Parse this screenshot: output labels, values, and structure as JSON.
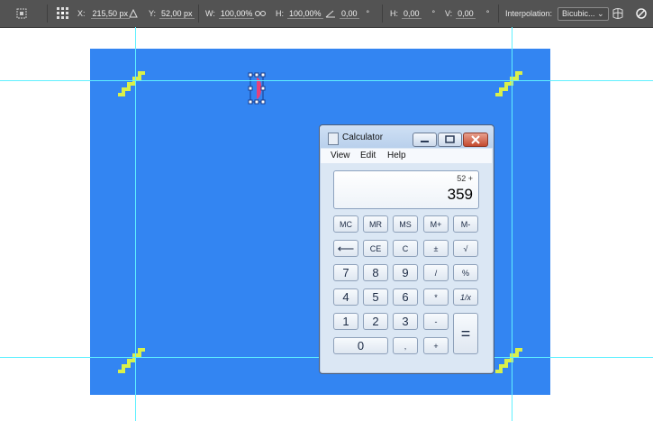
{
  "options_bar": {
    "x_label": "X:",
    "x_value": "215,50 px",
    "y_label": "Y:",
    "y_value": "52,00 px",
    "w_label": "W:",
    "w_value": "100,00%",
    "h_label": "H:",
    "h_value": "100,00%",
    "angle_value": "0,00",
    "angle_unit": "°",
    "hskew_label": "H:",
    "hskew_value": "0,00",
    "hskew_unit": "°",
    "vskew_label": "V:",
    "vskew_value": "0,00",
    "vskew_unit": "°",
    "interpolation_label": "Interpolation:",
    "interpolation_value": "Bicubic..."
  },
  "calculator": {
    "title": "Calculator",
    "menu": [
      "View",
      "Edit",
      "Help"
    ],
    "history": "52 +",
    "display": "359",
    "keys": {
      "mc": "MC",
      "mr": "MR",
      "ms": "MS",
      "mplus": "M+",
      "mminus": "M-",
      "back": "⟵",
      "ce": "CE",
      "c": "C",
      "plusminus": "±",
      "sqrt": "√",
      "k7": "7",
      "k8": "8",
      "k9": "9",
      "div": "/",
      "pct": "%",
      "k4": "4",
      "k5": "5",
      "k6": "6",
      "mul": "*",
      "recip": "1/x",
      "k1": "1",
      "k2": "2",
      "k3": "3",
      "minus": "-",
      "equals": "=",
      "k0": "0",
      "dot": ",",
      "plus": "+"
    }
  },
  "colors": {
    "canvas": "#3385f2",
    "guides": "#5ff0ff",
    "stairs": "#d9f04a",
    "selection": "#e8427a"
  }
}
